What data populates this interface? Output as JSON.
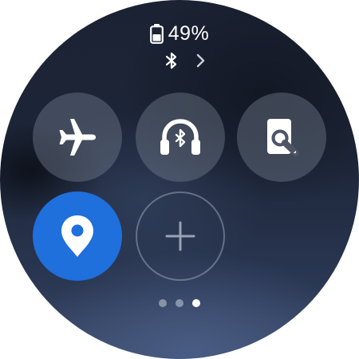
{
  "status": {
    "battery_percent": "49%",
    "battery_level": 0.49,
    "icons": [
      "battery-icon",
      "bluetooth-icon",
      "chevron-right-icon"
    ]
  },
  "tiles": [
    {
      "icon": "airplane-icon",
      "state": "off"
    },
    {
      "icon": "bluetooth-headphones-icon",
      "state": "off"
    },
    {
      "icon": "find-device-icon",
      "state": "off"
    },
    {
      "icon": "location-pin-icon",
      "state": "on"
    },
    {
      "icon": "plus-icon",
      "state": "add"
    }
  ],
  "page_indicator": {
    "total": 3,
    "current": 3
  },
  "colors": {
    "accent": "#1f6fdc",
    "tile_bg": "#6b7384",
    "text": "#ffffff"
  }
}
